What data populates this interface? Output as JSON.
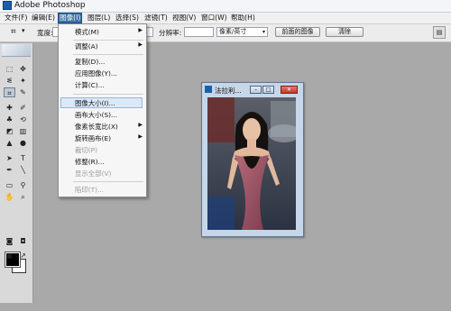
{
  "app": {
    "title": "Adobe Photoshop"
  },
  "menubar": {
    "items": [
      {
        "label": "文件(F)"
      },
      {
        "label": "编辑(E)"
      },
      {
        "label": "图像(I)"
      },
      {
        "label": "图层(L)"
      },
      {
        "label": "选择(S)"
      },
      {
        "label": "滤镜(T)"
      },
      {
        "label": "视图(V)"
      },
      {
        "label": "窗口(W)"
      },
      {
        "label": "帮助(H)"
      }
    ]
  },
  "options": {
    "width_label": "宽度:",
    "resolution_label": "分辨率:",
    "unit_value": "像素/英寸",
    "front_image_button": "前面的图像",
    "clear_button": "清除"
  },
  "image_menu": {
    "items": [
      {
        "label": "模式(M)",
        "submenu": true,
        "disabled": false
      },
      {
        "label": "调整(A)",
        "submenu": true,
        "disabled": false
      },
      {
        "label": "复制(D)...",
        "submenu": false,
        "disabled": false
      },
      {
        "label": "应用图像(Y)...",
        "submenu": false,
        "disabled": false
      },
      {
        "label": "计算(C)...",
        "submenu": false,
        "disabled": false
      },
      {
        "label": "图像大小(I)...",
        "submenu": false,
        "disabled": false,
        "highlighted": true
      },
      {
        "label": "画布大小(S)...",
        "submenu": false,
        "disabled": false
      },
      {
        "label": "像素长宽比(X)",
        "submenu": true,
        "disabled": false
      },
      {
        "label": "旋转画布(E)",
        "submenu": true,
        "disabled": false
      },
      {
        "label": "裁切(P)",
        "submenu": false,
        "disabled": true
      },
      {
        "label": "修整(R)...",
        "submenu": false,
        "disabled": false
      },
      {
        "label": "显示全部(V)",
        "submenu": false,
        "disabled": true
      },
      {
        "label": "陷印(T)...",
        "submenu": false,
        "disabled": true
      }
    ]
  },
  "document": {
    "title": "法拉利..."
  },
  "colors": {
    "menu_highlight": "#3a6ea5",
    "canvas_bg": "#a9a9a9",
    "close_button": "#c0392b"
  },
  "icons": [
    "photoshop-icon",
    "crop-icon",
    "marquee-icon",
    "move-icon",
    "lasso-icon",
    "magic-wand-icon",
    "brush-icon",
    "stamp-icon",
    "eraser-icon",
    "gradient-icon",
    "pen-icon",
    "text-icon",
    "hand-icon",
    "zoom-icon",
    "quick-mask-icon",
    "screen-mode-icon",
    "palette-well-icon"
  ]
}
